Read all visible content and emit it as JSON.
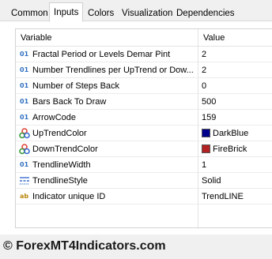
{
  "tabs": [
    {
      "label": "Common"
    },
    {
      "label": "Inputs"
    },
    {
      "label": "Colors"
    },
    {
      "label": "Visualization"
    },
    {
      "label": "Dependencies"
    }
  ],
  "active_tab": "Inputs",
  "grid": {
    "col_variable": "Variable",
    "col_value": "Value",
    "rows": [
      {
        "icon": "integer-icon",
        "name": "Fractal Period or Levels Demar Pint",
        "value": "2"
      },
      {
        "icon": "integer-icon",
        "name": "Number  Trendlines per UpTrend or Dow...",
        "value": "2"
      },
      {
        "icon": "integer-icon",
        "name": "Number of Steps Back",
        "value": "0"
      },
      {
        "icon": "integer-icon",
        "name": "Bars Back To Draw",
        "value": "500"
      },
      {
        "icon": "integer-icon",
        "name": "ArrowCode",
        "value": "159"
      },
      {
        "icon": "color-icon",
        "name": "UpTrendColor",
        "value": "DarkBlue",
        "swatch": "#00008b"
      },
      {
        "icon": "color-icon",
        "name": "DownTrendColor",
        "value": "FireBrick",
        "swatch": "#b22222"
      },
      {
        "icon": "integer-icon",
        "name": "TrendlineWidth",
        "value": "1"
      },
      {
        "icon": "line-style-icon",
        "name": "TrendlineStyle",
        "value": "Solid"
      },
      {
        "icon": "string-icon",
        "name": "Indicator unique ID",
        "value": "TrendLINE"
      }
    ]
  },
  "integer_glyph": "01",
  "string_glyph": "ab",
  "footer": "© ForexMT4Indicators.com"
}
